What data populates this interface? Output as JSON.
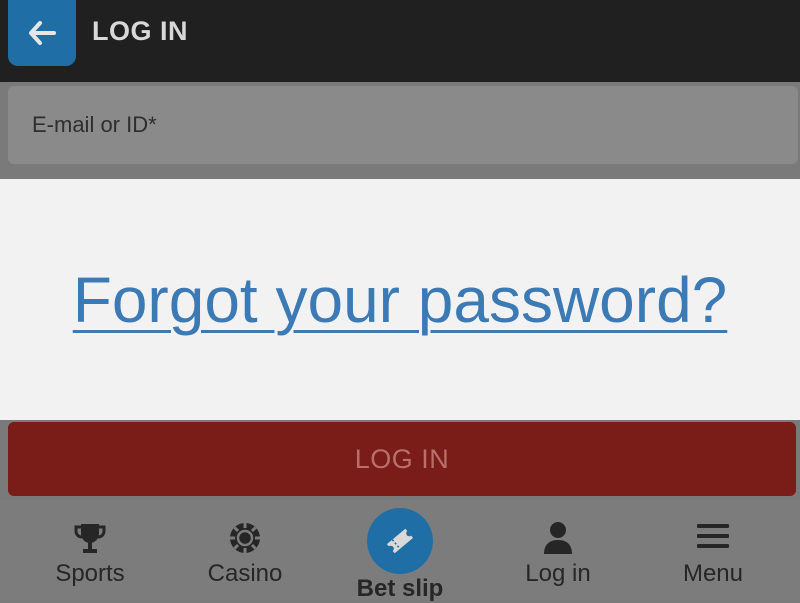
{
  "header": {
    "title": "LOG IN",
    "back_icon": "arrow-left-icon"
  },
  "login_form": {
    "email_placeholder": "E-mail or ID*",
    "forgot_link": "Forgot your password?",
    "submit_label": "LOG IN"
  },
  "bottom_nav": {
    "items": [
      {
        "label": "Sports",
        "icon": "trophy-icon"
      },
      {
        "label": "Casino",
        "icon": "casino-chip-icon"
      },
      {
        "label": "Bet slip",
        "icon": "ticket-icon"
      },
      {
        "label": "Log in",
        "icon": "user-icon"
      },
      {
        "label": "Menu",
        "icon": "hamburger-menu-icon"
      }
    ]
  },
  "colors": {
    "accent_blue": "#1f6fa6",
    "link_blue": "#3b7ab5",
    "login_red": "#7a1c17",
    "header_dark": "#202020"
  }
}
